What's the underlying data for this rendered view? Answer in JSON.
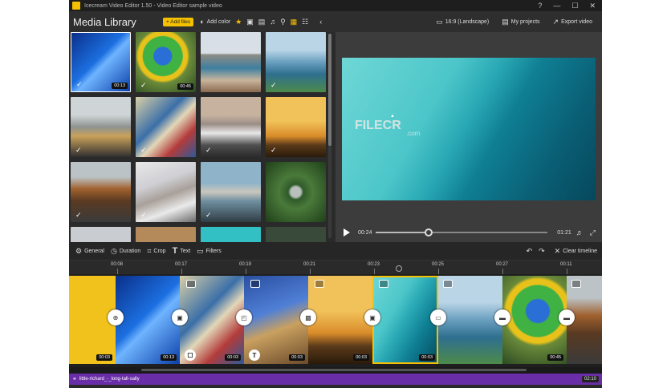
{
  "window": {
    "title": "Icecream Video Editor 1.50 - Video Editor sample video",
    "controls": [
      "—",
      "☐",
      "✕"
    ],
    "help_icon": "?"
  },
  "toolbar": {
    "library_title": "Media Library",
    "add_files": "+ Add files",
    "add_color": "Add color",
    "aspect": "16:9 (Landscape)",
    "my_projects": "My projects",
    "export": "Export video"
  },
  "media": [
    {
      "duration": "00:13",
      "checked": true
    },
    {
      "duration": "00:45",
      "checked": true
    },
    {
      "duration": "",
      "checked": false
    },
    {
      "duration": "",
      "checked": true
    },
    {
      "duration": "",
      "checked": true
    },
    {
      "duration": "",
      "checked": true
    },
    {
      "duration": "",
      "checked": true
    },
    {
      "duration": "",
      "checked": true
    },
    {
      "duration": "",
      "checked": true
    },
    {
      "duration": "",
      "checked": true
    },
    {
      "duration": "",
      "checked": true
    },
    {
      "duration": "",
      "checked": false
    }
  ],
  "player": {
    "current": "00:24",
    "total": "01:21",
    "progress": 0.31
  },
  "watermark": {
    "text": "FILECR",
    "sub": ".com"
  },
  "edit_tools": [
    "General",
    "Duration",
    "Crop",
    "Text",
    "Filters"
  ],
  "clear_timeline": "Clear timeline",
  "ruler": [
    "00:08",
    "00:17",
    "00:19",
    "00:21",
    "00:23",
    "00:25",
    "00:27",
    "00:11"
  ],
  "clips": [
    {
      "duration": "00:03"
    },
    {
      "duration": "00:13"
    },
    {
      "duration": "00:03"
    },
    {
      "duration": "00:03"
    },
    {
      "duration": "00:03"
    },
    {
      "duration": "00:03"
    },
    {
      "duration": ""
    },
    {
      "duration": "00:45"
    },
    {
      "duration": ""
    }
  ],
  "audio": {
    "name": "little-richard_-_long-tall-sally",
    "duration": "02:10"
  },
  "colors": {
    "accent": "#f5c000",
    "audio": "#6a2da8"
  }
}
